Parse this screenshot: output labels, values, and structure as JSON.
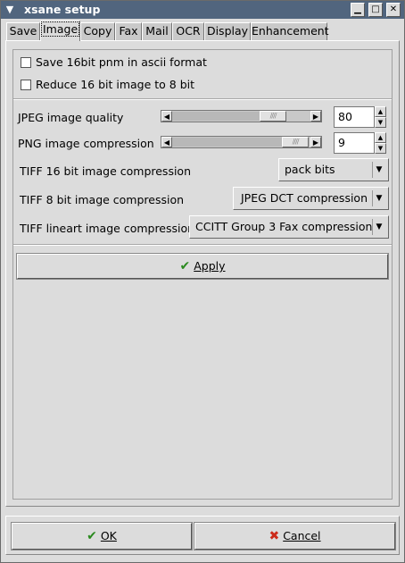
{
  "window": {
    "title": "xsane setup",
    "menu_icon": "chevron-down-icon",
    "controls": [
      "minimize-icon",
      "maximize-icon",
      "close-icon"
    ]
  },
  "tabs": [
    {
      "label": "Save",
      "active": false
    },
    {
      "label": "Image",
      "active": true
    },
    {
      "label": "Copy",
      "active": false
    },
    {
      "label": "Fax",
      "active": false
    },
    {
      "label": "Mail",
      "active": false
    },
    {
      "label": "OCR",
      "active": false
    },
    {
      "label": "Display",
      "active": false
    },
    {
      "label": "Enhancement",
      "active": false
    }
  ],
  "image": {
    "save16_label": "Save 16bit pnm in ascii format",
    "save16_checked": false,
    "reduce16_label": "Reduce 16 bit image to 8 bit",
    "reduce16_checked": false,
    "jpeg_quality_label": "JPEG image quality",
    "jpeg_quality_value": "80",
    "png_compression_label": "PNG image compression",
    "png_compression_value": "9",
    "tiff16_label": "TIFF 16 bit image compression",
    "tiff16_value": "pack bits",
    "tiff8_label": "TIFF 8 bit image compression",
    "tiff8_value": "JPEG DCT compression",
    "tiff_lineart_label": "TIFF lineart image compression",
    "tiff_lineart_value": "CCITT Group 3 Fax compression",
    "apply_label": "Apply"
  },
  "footer": {
    "ok_label": "OK",
    "cancel_label": "Cancel"
  },
  "colors": {
    "titlebar": "#51657e",
    "ok_check": "#2a8a1e",
    "cancel_x": "#cc2a1a"
  }
}
